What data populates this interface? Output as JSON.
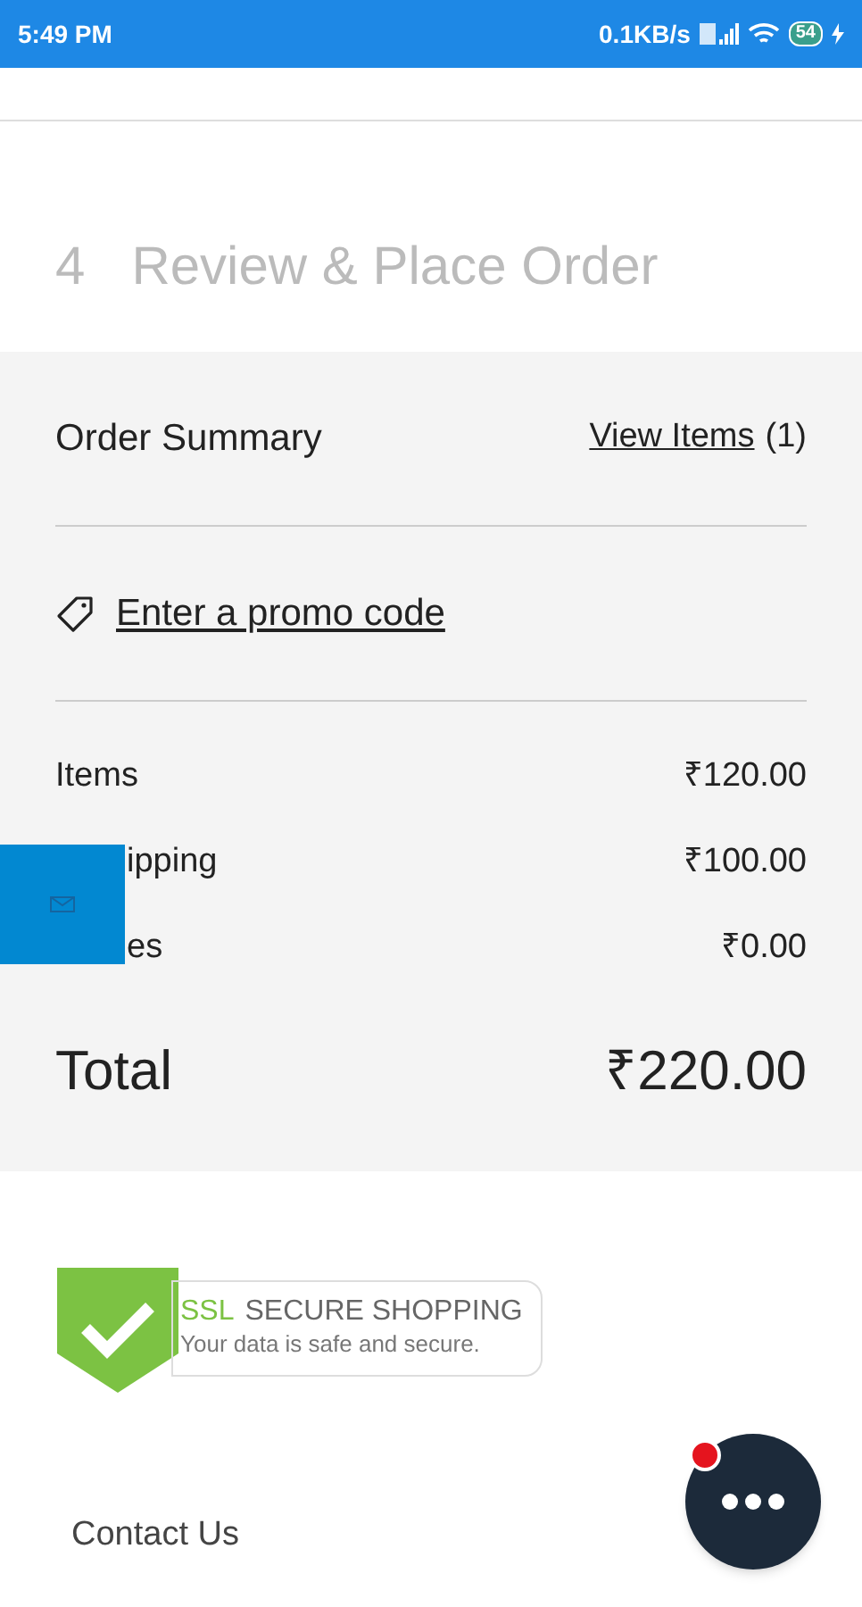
{
  "status_bar": {
    "time": "5:49 PM",
    "speed": "0.1KB/s",
    "battery": "54"
  },
  "step": {
    "number": "4",
    "title": "Review & Place Order"
  },
  "summary": {
    "title": "Order Summary",
    "view_items": "View Items",
    "count": "(1)",
    "promo": "Enter a promo code",
    "rows": [
      {
        "kind": "plain",
        "label": "Items",
        "value": "₹120.00"
      },
      {
        "kind": "beside_tab",
        "label": "ipping",
        "value": "₹100.00"
      },
      {
        "kind": "beside_tab",
        "label": "es",
        "value": "₹0.00"
      }
    ],
    "total_label": "Total",
    "total_value": "₹220.00"
  },
  "badge": {
    "ssl": "SSL",
    "secure": "SECURE SHOPPING",
    "subtitle": "Your data is safe and secure."
  },
  "contact": "Contact Us",
  "chat": {
    "unread": true
  }
}
